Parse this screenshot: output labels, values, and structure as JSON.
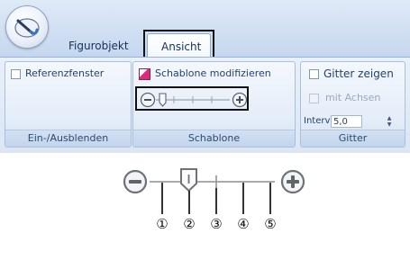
{
  "ribbon": {
    "tabs": [
      {
        "label": "Figurobjekt",
        "active": false
      },
      {
        "label": "Ansicht",
        "active": true
      }
    ],
    "groups": [
      {
        "caption": "Ein-/Ausblenden",
        "items": [
          {
            "label": "Referenzfenster",
            "checked": false
          }
        ]
      },
      {
        "caption": "Schablone",
        "items": [
          {
            "label": "Schablone modifizieren"
          }
        ]
      },
      {
        "caption": "Gitter",
        "items": [
          {
            "label": "Gitter zeigen",
            "checked": false,
            "enabled": true
          },
          {
            "label": "mit Achsen",
            "checked": false,
            "enabled": false
          }
        ],
        "interval_label": "Intervall:",
        "interval_value": "5,0"
      }
    ]
  },
  "slider": {
    "minus_icon": "zoom-out-minus-icon",
    "plus_icon": "zoom-in-plus-icon",
    "thumb_position": 1,
    "stops": 5
  },
  "callouts": [
    "①",
    "②",
    "③",
    "④",
    "⑤"
  ],
  "colors": {
    "ribbon_blue": "#c4d6ee",
    "text_blue": "#1e3f66",
    "highlight_border": "#111111",
    "schablone_icon": "#e0287c"
  }
}
